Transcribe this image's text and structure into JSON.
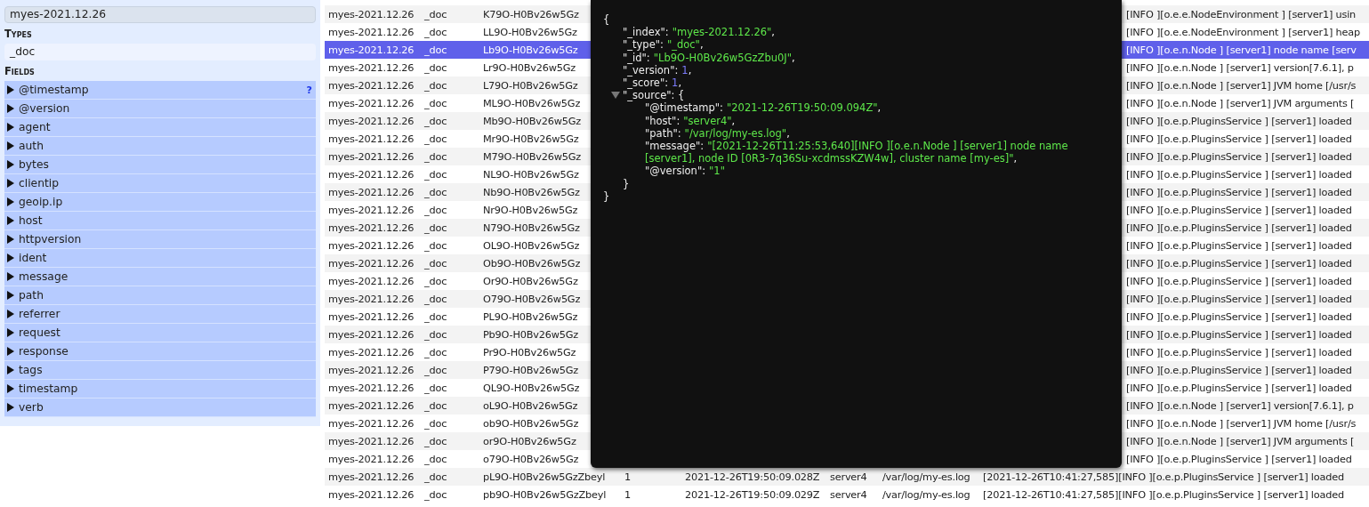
{
  "sidebar": {
    "indices": [
      {
        "label": "myes-2021.12.26",
        "selected": true
      }
    ],
    "types_heading": "Types",
    "types": [
      {
        "label": "_doc",
        "selected": false
      }
    ],
    "fields_heading": "Fields",
    "fields": [
      {
        "label": "@timestamp",
        "expanded": false,
        "help": "?"
      },
      {
        "label": "@version",
        "expanded": false
      },
      {
        "label": "agent",
        "expanded": false
      },
      {
        "label": "auth",
        "expanded": false
      },
      {
        "label": "bytes",
        "expanded": false
      },
      {
        "label": "clientip",
        "expanded": false
      },
      {
        "label": "geoip.ip",
        "expanded": false
      },
      {
        "label": "host",
        "expanded": false
      },
      {
        "label": "httpversion",
        "expanded": false
      },
      {
        "label": "ident",
        "expanded": false
      },
      {
        "label": "message",
        "expanded": false
      },
      {
        "label": "path",
        "expanded": false
      },
      {
        "label": "referrer",
        "expanded": false
      },
      {
        "label": "request",
        "expanded": false
      },
      {
        "label": "response",
        "expanded": false
      },
      {
        "label": "tags",
        "expanded": false
      },
      {
        "label": "timestamp",
        "expanded": false
      },
      {
        "label": "verb",
        "expanded": false
      }
    ]
  },
  "table": {
    "rows": [
      {
        "kind": "partly_hidden",
        "selected": false,
        "cells": [
          "myes-2021.12.26",
          "_doc",
          "K79O-H0Bv26w5Gz",
          "[INFO ][o.e.e.NodeEnvironment ] [server1] usin"
        ]
      },
      {
        "kind": "partly_hidden",
        "selected": false,
        "cells": [
          "myes-2021.12.26",
          "_doc",
          "LL9O-H0Bv26w5Gz",
          "[INFO ][o.e.e.NodeEnvironment ] [server1] heap"
        ]
      },
      {
        "kind": "partly_hidden",
        "selected": true,
        "cells": [
          "myes-2021.12.26",
          "_doc",
          "Lb9O-H0Bv26w5Gz",
          "[INFO ][o.e.n.Node ] [server1] node name [serv"
        ]
      },
      {
        "kind": "partly_hidden",
        "selected": false,
        "cells": [
          "myes-2021.12.26",
          "_doc",
          "Lr9O-H0Bv26w5Gz",
          "[INFO ][o.e.n.Node ] [server1] version[7.6.1], p"
        ]
      },
      {
        "kind": "partly_hidden",
        "selected": false,
        "cells": [
          "myes-2021.12.26",
          "_doc",
          "L79O-H0Bv26w5Gz",
          "[INFO ][o.e.n.Node ] [server1] JVM home [/usr/s"
        ]
      },
      {
        "kind": "partly_hidden",
        "selected": false,
        "cells": [
          "myes-2021.12.26",
          "_doc",
          "ML9O-H0Bv26w5Gz",
          "[INFO ][o.e.n.Node ] [server1] JVM arguments ["
        ]
      },
      {
        "kind": "partly_hidden",
        "selected": false,
        "cells": [
          "myes-2021.12.26",
          "_doc",
          "Mb9O-H0Bv26w5Gz",
          "[INFO ][o.e.p.PluginsService ] [server1] loaded"
        ]
      },
      {
        "kind": "partly_hidden",
        "selected": false,
        "cells": [
          "myes-2021.12.26",
          "_doc",
          "Mr9O-H0Bv26w5Gz",
          "[INFO ][o.e.p.PluginsService ] [server1] loaded"
        ]
      },
      {
        "kind": "partly_hidden",
        "selected": false,
        "cells": [
          "myes-2021.12.26",
          "_doc",
          "M79O-H0Bv26w5Gz",
          "[INFO ][o.e.p.PluginsService ] [server1] loaded"
        ]
      },
      {
        "kind": "partly_hidden",
        "selected": false,
        "cells": [
          "myes-2021.12.26",
          "_doc",
          "NL9O-H0Bv26w5Gz",
          "[INFO ][o.e.p.PluginsService ] [server1] loaded"
        ]
      },
      {
        "kind": "partly_hidden",
        "selected": false,
        "cells": [
          "myes-2021.12.26",
          "_doc",
          "Nb9O-H0Bv26w5Gz",
          "[INFO ][o.e.p.PluginsService ] [server1] loaded"
        ]
      },
      {
        "kind": "partly_hidden",
        "selected": false,
        "cells": [
          "myes-2021.12.26",
          "_doc",
          "Nr9O-H0Bv26w5Gz",
          "[INFO ][o.e.p.PluginsService ] [server1] loaded"
        ]
      },
      {
        "kind": "partly_hidden",
        "selected": false,
        "cells": [
          "myes-2021.12.26",
          "_doc",
          "N79O-H0Bv26w5Gz",
          "[INFO ][o.e.p.PluginsService ] [server1] loaded"
        ]
      },
      {
        "kind": "partly_hidden",
        "selected": false,
        "cells": [
          "myes-2021.12.26",
          "_doc",
          "OL9O-H0Bv26w5Gz",
          "[INFO ][o.e.p.PluginsService ] [server1] loaded"
        ]
      },
      {
        "kind": "partly_hidden",
        "selected": false,
        "cells": [
          "myes-2021.12.26",
          "_doc",
          "Ob9O-H0Bv26w5Gz",
          "[INFO ][o.e.p.PluginsService ] [server1] loaded"
        ]
      },
      {
        "kind": "partly_hidden",
        "selected": false,
        "cells": [
          "myes-2021.12.26",
          "_doc",
          "Or9O-H0Bv26w5Gz",
          "[INFO ][o.e.p.PluginsService ] [server1] loaded"
        ]
      },
      {
        "kind": "partly_hidden",
        "selected": false,
        "cells": [
          "myes-2021.12.26",
          "_doc",
          "O79O-H0Bv26w5Gz",
          "[INFO ][o.e.p.PluginsService ] [server1] loaded"
        ]
      },
      {
        "kind": "partly_hidden",
        "selected": false,
        "cells": [
          "myes-2021.12.26",
          "_doc",
          "PL9O-H0Bv26w5Gz",
          "[INFO ][o.e.p.PluginsService ] [server1] loaded"
        ]
      },
      {
        "kind": "partly_hidden",
        "selected": false,
        "cells": [
          "myes-2021.12.26",
          "_doc",
          "Pb9O-H0Bv26w5Gz",
          "[INFO ][o.e.p.PluginsService ] [server1] loaded"
        ]
      },
      {
        "kind": "partly_hidden",
        "selected": false,
        "cells": [
          "myes-2021.12.26",
          "_doc",
          "Pr9O-H0Bv26w5Gz",
          "[INFO ][o.e.p.PluginsService ] [server1] loaded"
        ]
      },
      {
        "kind": "partly_hidden",
        "selected": false,
        "cells": [
          "myes-2021.12.26",
          "_doc",
          "P79O-H0Bv26w5Gz",
          "[INFO ][o.e.p.PluginsService ] [server1] loaded"
        ]
      },
      {
        "kind": "partly_hidden",
        "selected": false,
        "cells": [
          "myes-2021.12.26",
          "_doc",
          "QL9O-H0Bv26w5Gz",
          "[INFO ][o.e.p.PluginsService ] [server1] loaded"
        ]
      },
      {
        "kind": "partly_hidden",
        "selected": false,
        "cells": [
          "myes-2021.12.26",
          "_doc",
          "oL9O-H0Bv26w5Gz",
          "[INFO ][o.e.n.Node ] [server1] version[7.6.1], p"
        ]
      },
      {
        "kind": "partly_hidden",
        "selected": false,
        "cells": [
          "myes-2021.12.26",
          "_doc",
          "ob9O-H0Bv26w5Gz",
          "[INFO ][o.e.n.Node ] [server1] JVM home [/usr/s"
        ]
      },
      {
        "kind": "partly_hidden",
        "selected": false,
        "cells": [
          "myes-2021.12.26",
          "_doc",
          "or9O-H0Bv26w5Gz",
          "[INFO ][o.e.n.Node ] [server1] JVM arguments ["
        ]
      },
      {
        "kind": "partly_hidden",
        "selected": false,
        "cells": [
          "myes-2021.12.26",
          "_doc",
          "o79O-H0Bv26w5Gz",
          "[INFO ][o.e.p.PluginsService ] [server1] loaded"
        ]
      },
      {
        "kind": "full",
        "selected": false,
        "cells": [
          "myes-2021.12.26",
          "_doc",
          "pL9O-H0Bv26w5GzZbeyl",
          "1",
          "2021-12-26T19:50:09.028Z",
          "server4",
          "/var/log/my-es.log",
          "[2021-12-26T10:41:27,585][INFO ][o.e.p.PluginsService ] [server1] loaded"
        ]
      },
      {
        "kind": "full",
        "selected": false,
        "cells": [
          "myes-2021.12.26",
          "_doc",
          "pb9O-H0Bv26w5GzZbeyl",
          "1",
          "2021-12-26T19:50:09.029Z",
          "server4",
          "/var/log/my-es.log",
          "[2021-12-26T10:41:27,585][INFO ][o.e.p.PluginsService ] [server1] loaded"
        ]
      }
    ]
  },
  "document_popup": {
    "open": "{",
    "close": "}",
    "fields": [
      {
        "kind": "string",
        "key": "\"_index\":",
        "value": "\"myes-2021.12.26\"",
        "sep": ","
      },
      {
        "kind": "string",
        "key": "\"_type\":",
        "value": "\"_doc\"",
        "sep": ","
      },
      {
        "kind": "string",
        "key": "\"_id\":",
        "value": "\"Lb9O-H0Bv26w5GzZbu0J\"",
        "sep": ","
      },
      {
        "kind": "number",
        "key": "\"_version\":",
        "value": "1",
        "sep": ","
      },
      {
        "kind": "number",
        "key": "\"_score\":",
        "value": "1",
        "sep": ","
      },
      {
        "kind": "object",
        "key": "\"_source\":",
        "expanded": true,
        "open": "{",
        "close": "}",
        "children": [
          {
            "kind": "string",
            "key": "\"@timestamp\":",
            "value": "\"2021-12-26T19:50:09.094Z\"",
            "sep": ","
          },
          {
            "kind": "string",
            "key": "\"host\":",
            "value": "\"server4\"",
            "sep": ","
          },
          {
            "kind": "string",
            "key": "\"path\":",
            "value": "\"/var/log/my-es.log\"",
            "sep": ","
          },
          {
            "kind": "string",
            "key": "\"message\":",
            "value": "\"[2021-12-26T11:25:53,640][INFO ][o.e.n.Node ] [server1] node name [server1], node ID [0R3-7q36Su-xcdmssKZW4w], cluster name [my-es]\"",
            "sep": ","
          },
          {
            "kind": "string",
            "key": "\"@version\":",
            "value": "\"1\""
          }
        ]
      }
    ]
  }
}
